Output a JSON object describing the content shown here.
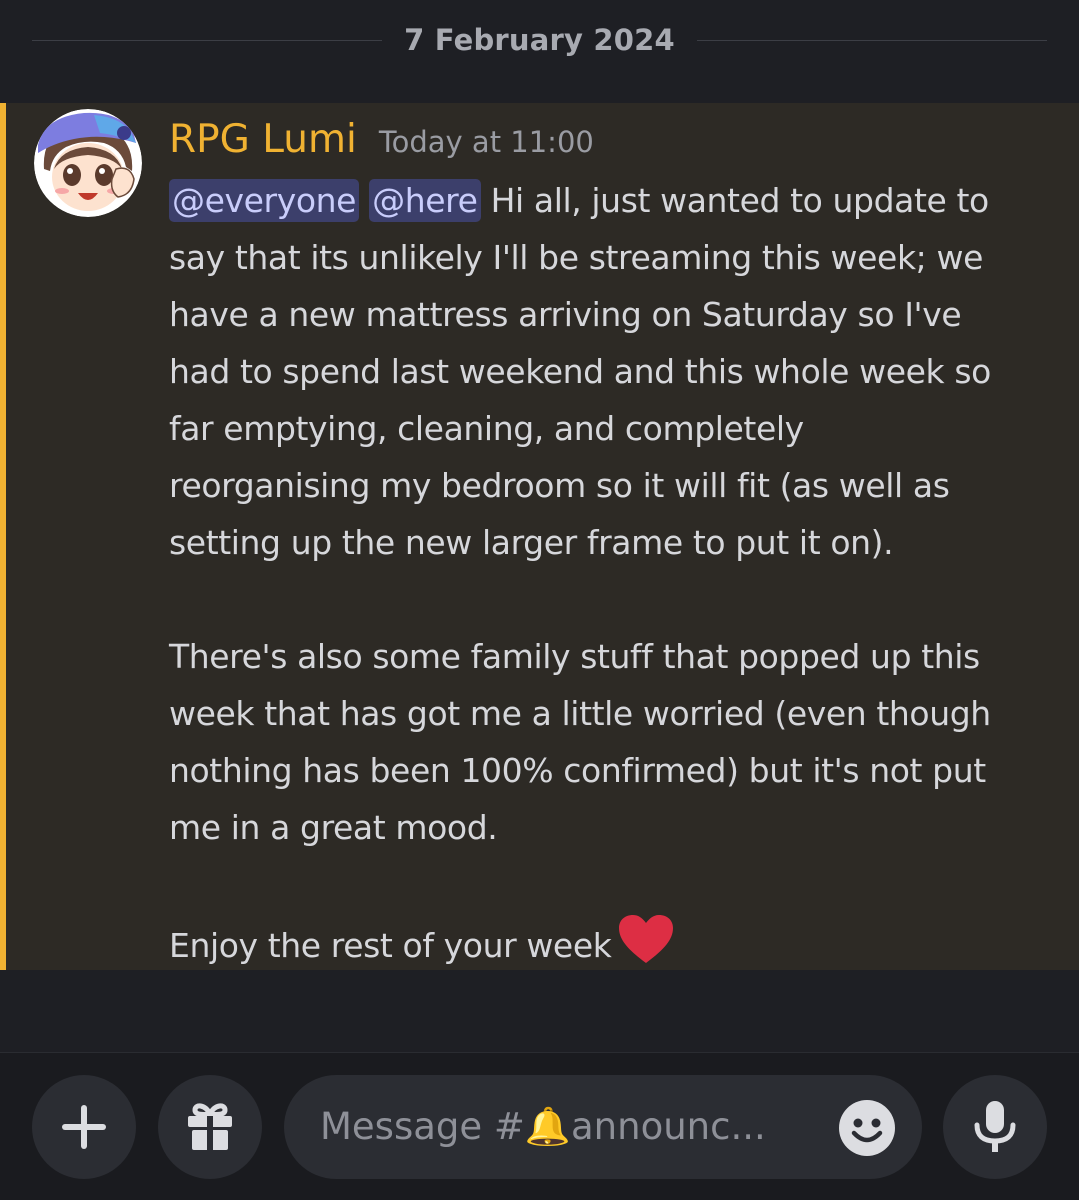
{
  "divider": {
    "date": "7 February 2024"
  },
  "message": {
    "author": "RPG Lumi",
    "timestamp": "Today at 11:00",
    "highlight_color": "#f0b232",
    "mentions": [
      "@everyone",
      "@here"
    ],
    "line1_rest": " Hi all, just wanted to update to",
    "lines_p1": [
      "say that its unlikely I'll be streaming this week; we",
      "have a new mattress arriving on Saturday so I've",
      "had to spend last weekend and this whole week so",
      "far emptying, cleaning, and completely",
      "reorganising my bedroom so it will fit (as well as",
      "setting up the new larger frame to put it on)."
    ],
    "lines_p2": [
      "There's also some family stuff that popped up this",
      "week that has got me a little worried (even though",
      "nothing has been 100% confirmed) but it's not put",
      "me in a great mood."
    ],
    "closing": "Enjoy the rest of your week",
    "closing_emoji": "heart-emoji"
  },
  "composer": {
    "placeholder": "Message #🔔announc...",
    "buttons": [
      "plus-icon",
      "gift-icon",
      "emoji-icon",
      "microphone-icon"
    ]
  }
}
